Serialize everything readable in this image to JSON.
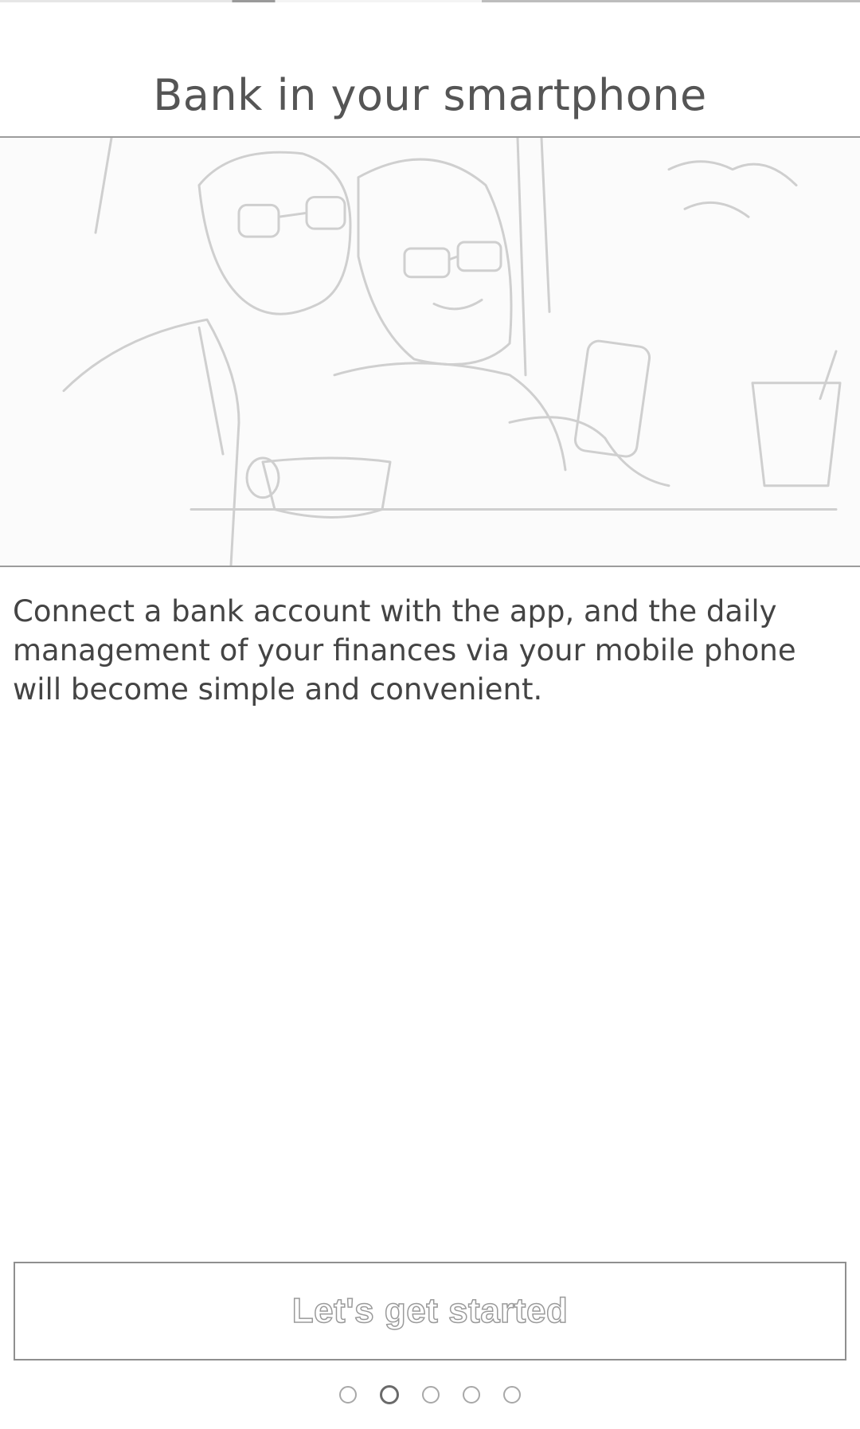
{
  "onboarding": {
    "title": "Bank in your smartphone",
    "description": "Connect a bank account with the app, and the daily management of your finances via your mobile phone will become simple and convenient.",
    "cta_label": "Let's get started",
    "pager": {
      "total": 5,
      "current": 2
    }
  },
  "hero_image": {
    "icon": "photo-people-with-smartphone"
  }
}
